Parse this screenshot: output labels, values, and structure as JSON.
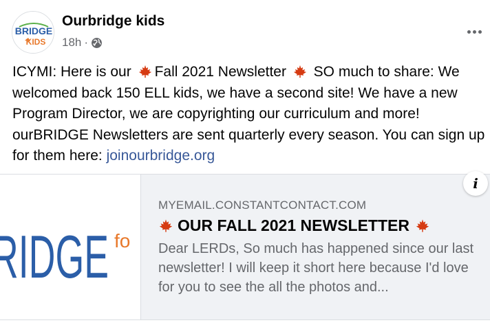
{
  "post": {
    "author": "Ourbridge kids",
    "time": "18h",
    "separator": "·",
    "avatar_logo": {
      "line1": "BRIDGE",
      "line2": "KIDS",
      "colors": {
        "blue": "#2b5ea8",
        "orange": "#e8782a",
        "green": "#5bb04a"
      }
    },
    "text": {
      "part1": "ICYMI: Here is our",
      "part2": "Fall 2021 Newsletter",
      "part3": "SO much to share: We welcomed back 150 ELL kids, we have a second site! We have a new Program Director, we are copyrighting our curriculum and more! ourBRIDGE Newsletters are sent quarterly every season. You can sign up for them here:",
      "link": "joinourbridge.org"
    },
    "emoji": "maple-leaf-icon",
    "leaf_color": "#d63b12",
    "link_color": "#385898"
  },
  "preview": {
    "image_text": "RIDGE",
    "image_sub": "fo",
    "image_color": "#2b5ea8",
    "image_sub_color": "#e8782a",
    "domain": "MYEMAIL.CONSTANTCONTACT.COM",
    "headline": "OUR FALL 2021 NEWSLETTER",
    "description": "Dear LERDs, So much has happened since our last newsletter! I will keep it short here because I'd love for you to see the all the photos and..."
  },
  "info_button": "i"
}
